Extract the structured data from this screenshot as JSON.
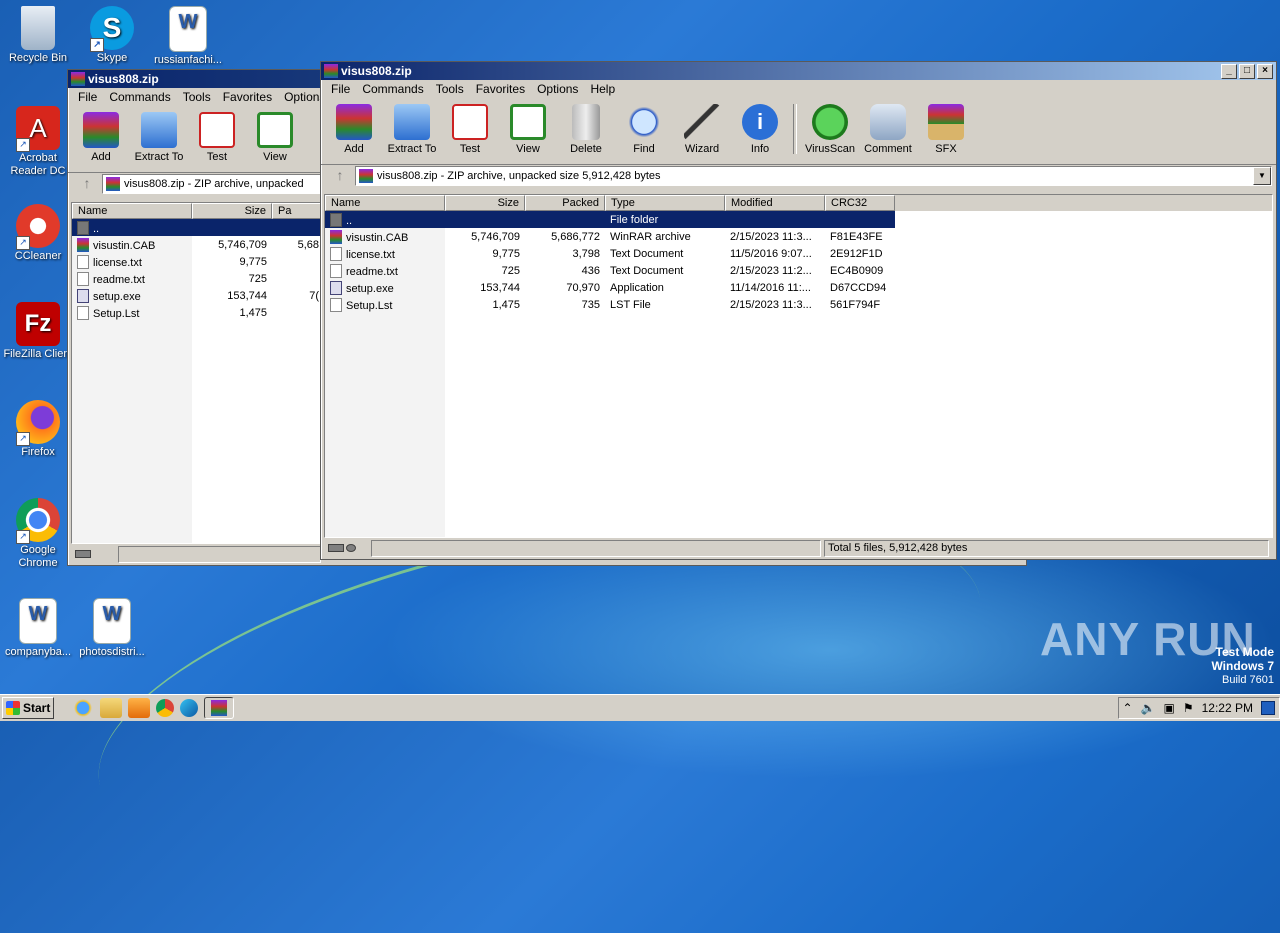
{
  "desktop": {
    "icons": [
      {
        "label": "Recycle Bin",
        "icon": "recycle-bin-icon"
      },
      {
        "label": "Skype",
        "icon": "skype-icon"
      },
      {
        "label": "russianfachi...",
        "icon": "word-document-icon"
      },
      {
        "label": "Acrobat Reader DC",
        "icon": "acrobat-icon"
      },
      {
        "label": "CCleaner",
        "icon": "ccleaner-icon"
      },
      {
        "label": "FileZilla Client",
        "icon": "filezilla-icon"
      },
      {
        "label": "Firefox",
        "icon": "firefox-icon"
      },
      {
        "label": "Google Chrome",
        "icon": "chrome-icon"
      },
      {
        "label": "companyba...",
        "icon": "word-document-icon"
      },
      {
        "label": "photosdistri...",
        "icon": "word-document-icon"
      }
    ]
  },
  "back_window": {
    "title": "visus808.zip",
    "menu": [
      "File",
      "Commands",
      "Tools",
      "Favorites",
      "Options",
      "He"
    ],
    "toolbar": [
      "Add",
      "Extract To",
      "Test",
      "View"
    ],
    "address": "visus808.zip - ZIP archive, unpacked",
    "columns": [
      "Name",
      "Size",
      "Pa"
    ],
    "rows": [
      {
        "name": "..",
        "size": "",
        "packed": ""
      },
      {
        "name": "visustin.CAB",
        "size": "5,746,709",
        "packed": "5,68"
      },
      {
        "name": "license.txt",
        "size": "9,775",
        "packed": ""
      },
      {
        "name": "readme.txt",
        "size": "725",
        "packed": ""
      },
      {
        "name": "setup.exe",
        "size": "153,744",
        "packed": "7("
      },
      {
        "name": "Setup.Lst",
        "size": "1,475",
        "packed": ""
      }
    ]
  },
  "main_window": {
    "title": "visus808.zip",
    "menu": [
      "File",
      "Commands",
      "Tools",
      "Favorites",
      "Options",
      "Help"
    ],
    "toolbar": [
      "Add",
      "Extract To",
      "Test",
      "View",
      "Delete",
      "Find",
      "Wizard",
      "Info",
      "VirusScan",
      "Comment",
      "SFX"
    ],
    "address": "visus808.zip - ZIP archive, unpacked size 5,912,428 bytes",
    "columns": [
      "Name",
      "Size",
      "Packed",
      "Type",
      "Modified",
      "CRC32"
    ],
    "rows": [
      {
        "name": "..",
        "size": "",
        "packed": "",
        "type": "File folder",
        "modified": "",
        "crc": ""
      },
      {
        "name": "visustin.CAB",
        "size": "5,746,709",
        "packed": "5,686,772",
        "type": "WinRAR archive",
        "modified": "2/15/2023 11:3...",
        "crc": "F81E43FE"
      },
      {
        "name": "license.txt",
        "size": "9,775",
        "packed": "3,798",
        "type": "Text Document",
        "modified": "11/5/2016 9:07...",
        "crc": "2E912F1D"
      },
      {
        "name": "readme.txt",
        "size": "725",
        "packed": "436",
        "type": "Text Document",
        "modified": "2/15/2023 11:2...",
        "crc": "EC4B0909"
      },
      {
        "name": "setup.exe",
        "size": "153,744",
        "packed": "70,970",
        "type": "Application",
        "modified": "11/14/2016 11:...",
        "crc": "D67CCD94"
      },
      {
        "name": "Setup.Lst",
        "size": "1,475",
        "packed": "735",
        "type": "LST File",
        "modified": "2/15/2023 11:3...",
        "crc": "561F794F"
      }
    ],
    "status": "Total 5 files, 5,912,428 bytes"
  },
  "taskbar": {
    "start": "Start",
    "clock": "12:22 PM"
  },
  "watermark": {
    "brand": "ANY RUN",
    "line1": "Test Mode",
    "line2": "Windows 7",
    "line3": "Build 7601"
  }
}
